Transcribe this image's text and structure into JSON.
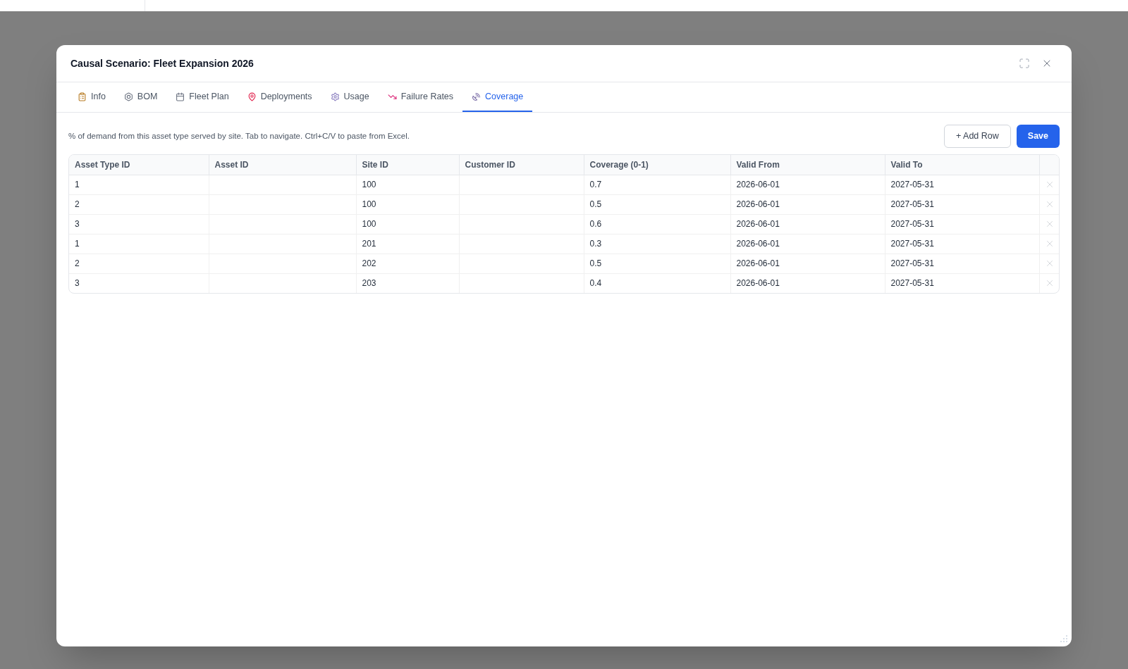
{
  "dialog": {
    "title": "Causal Scenario: Fleet Expansion 2026"
  },
  "tabs": [
    {
      "label": "Info",
      "selected": false
    },
    {
      "label": "BOM",
      "selected": false
    },
    {
      "label": "Fleet Plan",
      "selected": false
    },
    {
      "label": "Deployments",
      "selected": false
    },
    {
      "label": "Usage",
      "selected": false
    },
    {
      "label": "Failure Rates",
      "selected": false
    },
    {
      "label": "Coverage",
      "selected": true
    }
  ],
  "toolbar": {
    "hint": "% of demand from this asset type served by site. Tab to navigate. Ctrl+C/V to paste from Excel.",
    "buttons": [
      {
        "kind": "secondary",
        "label": "+ Add Row"
      },
      {
        "kind": "primary",
        "label": "Save"
      }
    ]
  },
  "table": {
    "columns": [
      "Asset Type ID",
      "Asset ID",
      "Site ID",
      "Customer ID",
      "Coverage (0-1)",
      "Valid From",
      "Valid To"
    ],
    "rows": [
      {
        "cells": [
          "1",
          null,
          "100",
          null,
          "0.7",
          "2026-06-01",
          "2027-05-31"
        ]
      },
      {
        "cells": [
          "2",
          null,
          "100",
          null,
          "0.5",
          "2026-06-01",
          "2027-05-31"
        ]
      },
      {
        "cells": [
          "3",
          null,
          "100",
          null,
          "0.6",
          "2026-06-01",
          "2027-05-31"
        ]
      },
      {
        "cells": [
          "1",
          null,
          "201",
          null,
          "0.3",
          "2026-06-01",
          "2027-05-31"
        ]
      },
      {
        "cells": [
          "2",
          null,
          "202",
          null,
          "0.5",
          "2026-06-01",
          "2027-05-31"
        ]
      },
      {
        "cells": [
          "3",
          null,
          "203",
          null,
          "0.4",
          "2026-06-01",
          "2027-05-31"
        ]
      }
    ]
  }
}
